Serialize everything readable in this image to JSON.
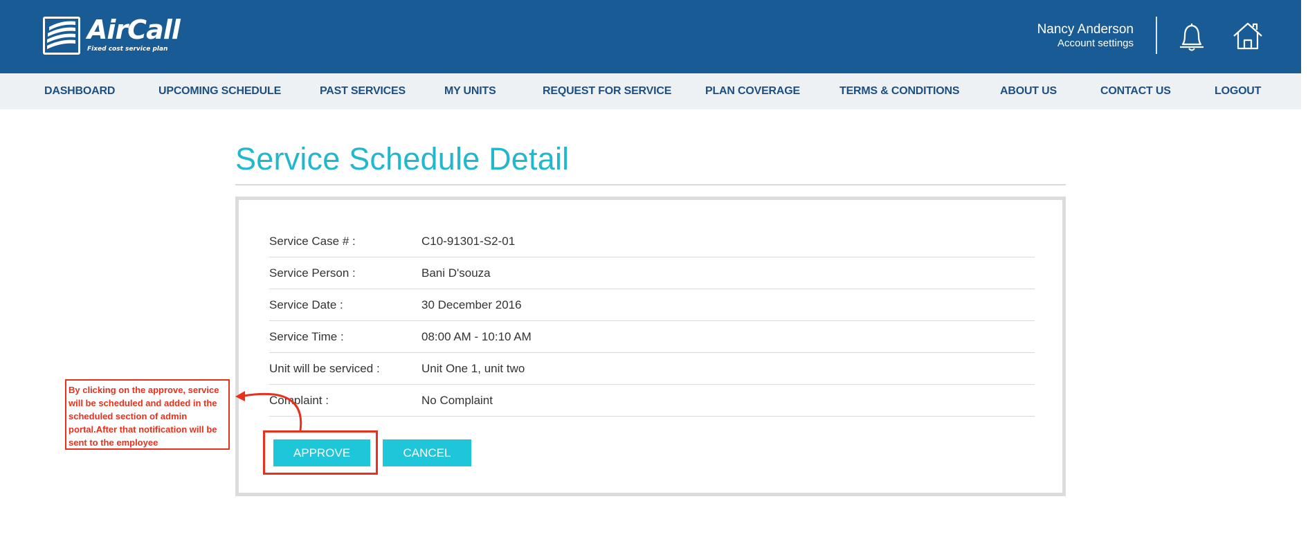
{
  "header": {
    "logo_name": "AirCall",
    "logo_tagline": "Fixed cost service plan",
    "user_name": "Nancy Anderson",
    "account_settings": "Account settings",
    "bell_icon": "bell-icon",
    "home_icon": "home-icon"
  },
  "nav": {
    "items": [
      {
        "label": "DASHBOARD"
      },
      {
        "label": "UPCOMING SCHEDULE"
      },
      {
        "label": "PAST SERVICES"
      },
      {
        "label": "MY UNITS"
      },
      {
        "label": "REQUEST FOR SERVICE"
      },
      {
        "label": "PLAN COVERAGE"
      },
      {
        "label": "TERMS & CONDITIONS"
      },
      {
        "label": "ABOUT US"
      },
      {
        "label": "CONTACT US"
      },
      {
        "label": "LOGOUT"
      }
    ]
  },
  "page": {
    "title": "Service Schedule Detail"
  },
  "details": [
    {
      "label": "Service Case # :",
      "value": "C10-91301-S2-01"
    },
    {
      "label": "Service Person :",
      "value": "Bani D'souza"
    },
    {
      "label": "Service Date :",
      "value": "30 December 2016"
    },
    {
      "label": "Service Time :",
      "value": "08:00 AM - 10:10 AM"
    },
    {
      "label": "Unit will be serviced :",
      "value": "Unit One 1, unit two"
    },
    {
      "label": "Complaint :",
      "value": "No Complaint"
    }
  ],
  "actions": {
    "approve": "APPROVE",
    "cancel": "CANCEL"
  },
  "annotation": {
    "text": "By clicking on the approve, service will be scheduled and added in the scheduled section of admin portal.After that notification will be sent to the employee"
  },
  "colors": {
    "header_bg": "#195b94",
    "nav_bg": "#eef1f4",
    "nav_text": "#1c4f82",
    "title": "#21b8ce",
    "button": "#1ec6d9",
    "annotation": "#e8301c"
  }
}
